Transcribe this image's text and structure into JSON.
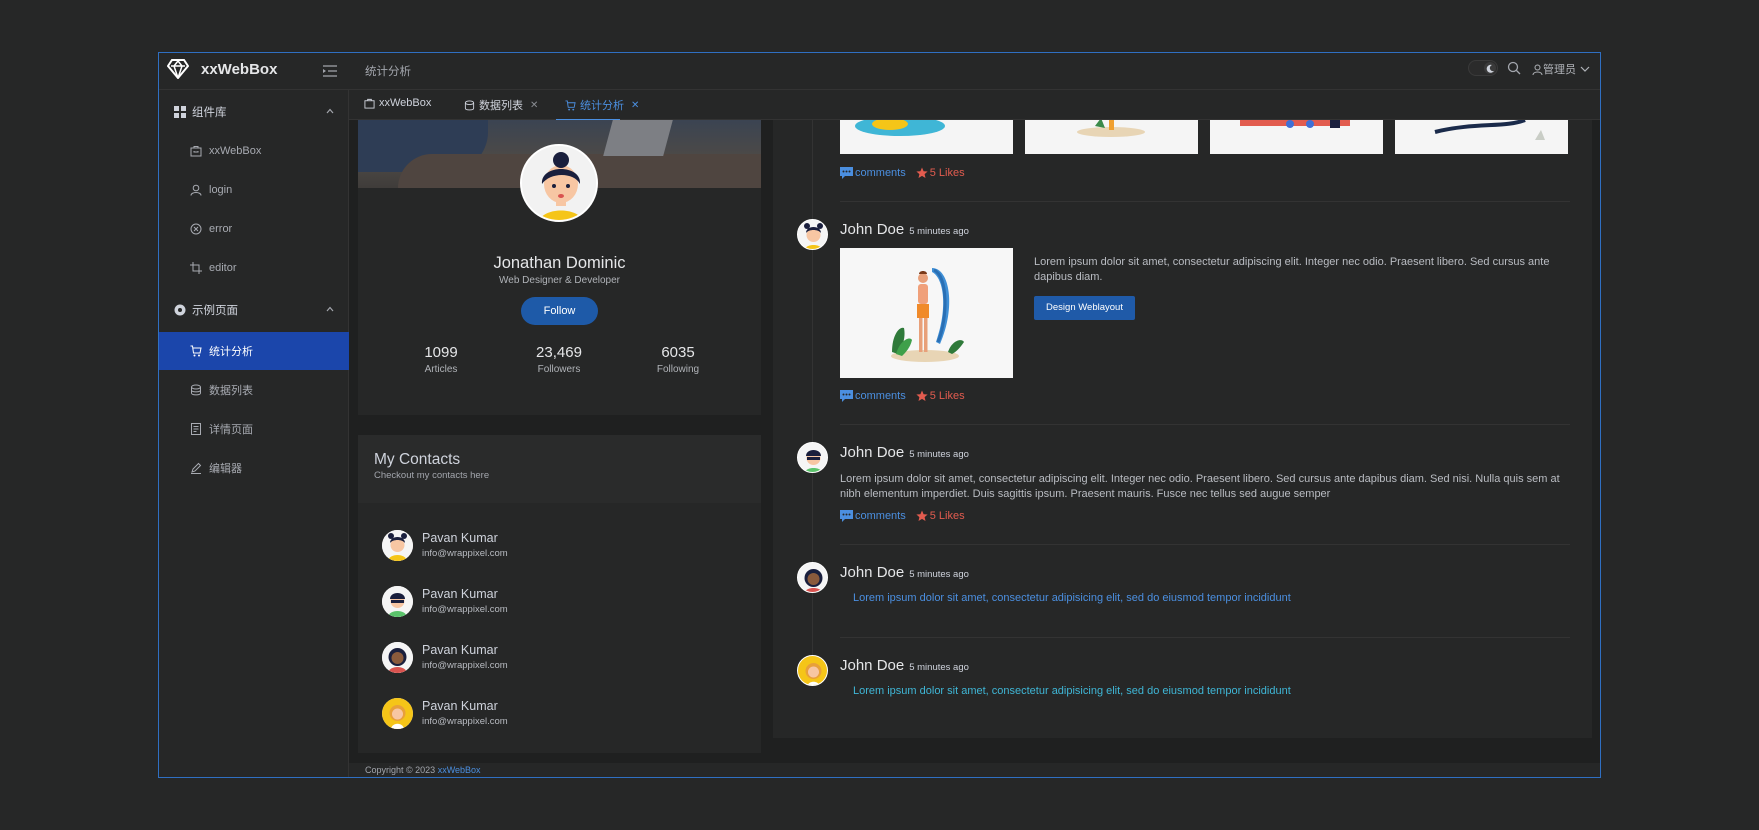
{
  "app": {
    "name": "xxWebBox"
  },
  "header": {
    "title": "统计分析",
    "user_label": "管理员"
  },
  "sidebar": {
    "groups": [
      {
        "label": "组件库",
        "items": [
          "xxWebBox",
          "login",
          "error",
          "editor"
        ]
      },
      {
        "label": "示例页面",
        "items": [
          "统计分析",
          "数据列表",
          "详情页面",
          "编辑器"
        ]
      }
    ]
  },
  "tabs": [
    {
      "label": "xxWebBox",
      "closable": false
    },
    {
      "label": "数据列表",
      "closable": true
    },
    {
      "label": "统计分析",
      "closable": true,
      "active": true
    }
  ],
  "profile": {
    "name": "Jonathan Dominic",
    "role": "Web Designer & Developer",
    "follow_label": "Follow",
    "stats": [
      {
        "value": "1099",
        "label": "Articles"
      },
      {
        "value": "23,469",
        "label": "Followers"
      },
      {
        "value": "6035",
        "label": "Following"
      }
    ]
  },
  "contacts": {
    "title": "My Contacts",
    "subtitle": "Checkout my contacts here",
    "items": [
      {
        "name": "Pavan Kumar",
        "email": "info@wrappixel.com"
      },
      {
        "name": "Pavan Kumar",
        "email": "info@wrappixel.com"
      },
      {
        "name": "Pavan Kumar",
        "email": "info@wrappixel.com"
      },
      {
        "name": "Pavan Kumar",
        "email": "info@wrappixel.com"
      }
    ]
  },
  "timeline": {
    "comments_label": "comments",
    "likes_label": "5 Likes",
    "posts": [
      {
        "author": "John Doe",
        "time": "5 minutes ago",
        "text": "Lorem ipsum dolor sit amet, consectetur adipiscing elit. Integer nec odio. Praesent libero. Sed cursus ante dapibus diam.",
        "button": "Design Weblayout"
      },
      {
        "author": "John Doe",
        "time": "5 minutes ago",
        "text": "Lorem ipsum dolor sit amet, consectetur adipiscing elit. Integer nec odio. Praesent libero. Sed cursus ante dapibus diam. Sed nisi. Nulla quis sem at nibh elementum imperdiet. Duis sagittis ipsum. Praesent mauris. Fusce nec tellus sed augue semper"
      },
      {
        "author": "John Doe",
        "time": "5 minutes ago",
        "link": "Lorem ipsum dolor sit amet, consectetur adipisicing elit, sed do eiusmod tempor incididunt"
      },
      {
        "author": "John Doe",
        "time": "5 minutes ago",
        "link": "Lorem ipsum dolor sit amet, consectetur adipisicing elit, sed do eiusmod tempor incididunt"
      }
    ]
  },
  "footer": {
    "copyright": "Copyright © 2023 ",
    "brand": "xxWebBox"
  },
  "colors": {
    "accent": "#1b46ab",
    "link": "#4b8fe0",
    "likes": "#e25c4f",
    "border": "#2f6fc2"
  }
}
